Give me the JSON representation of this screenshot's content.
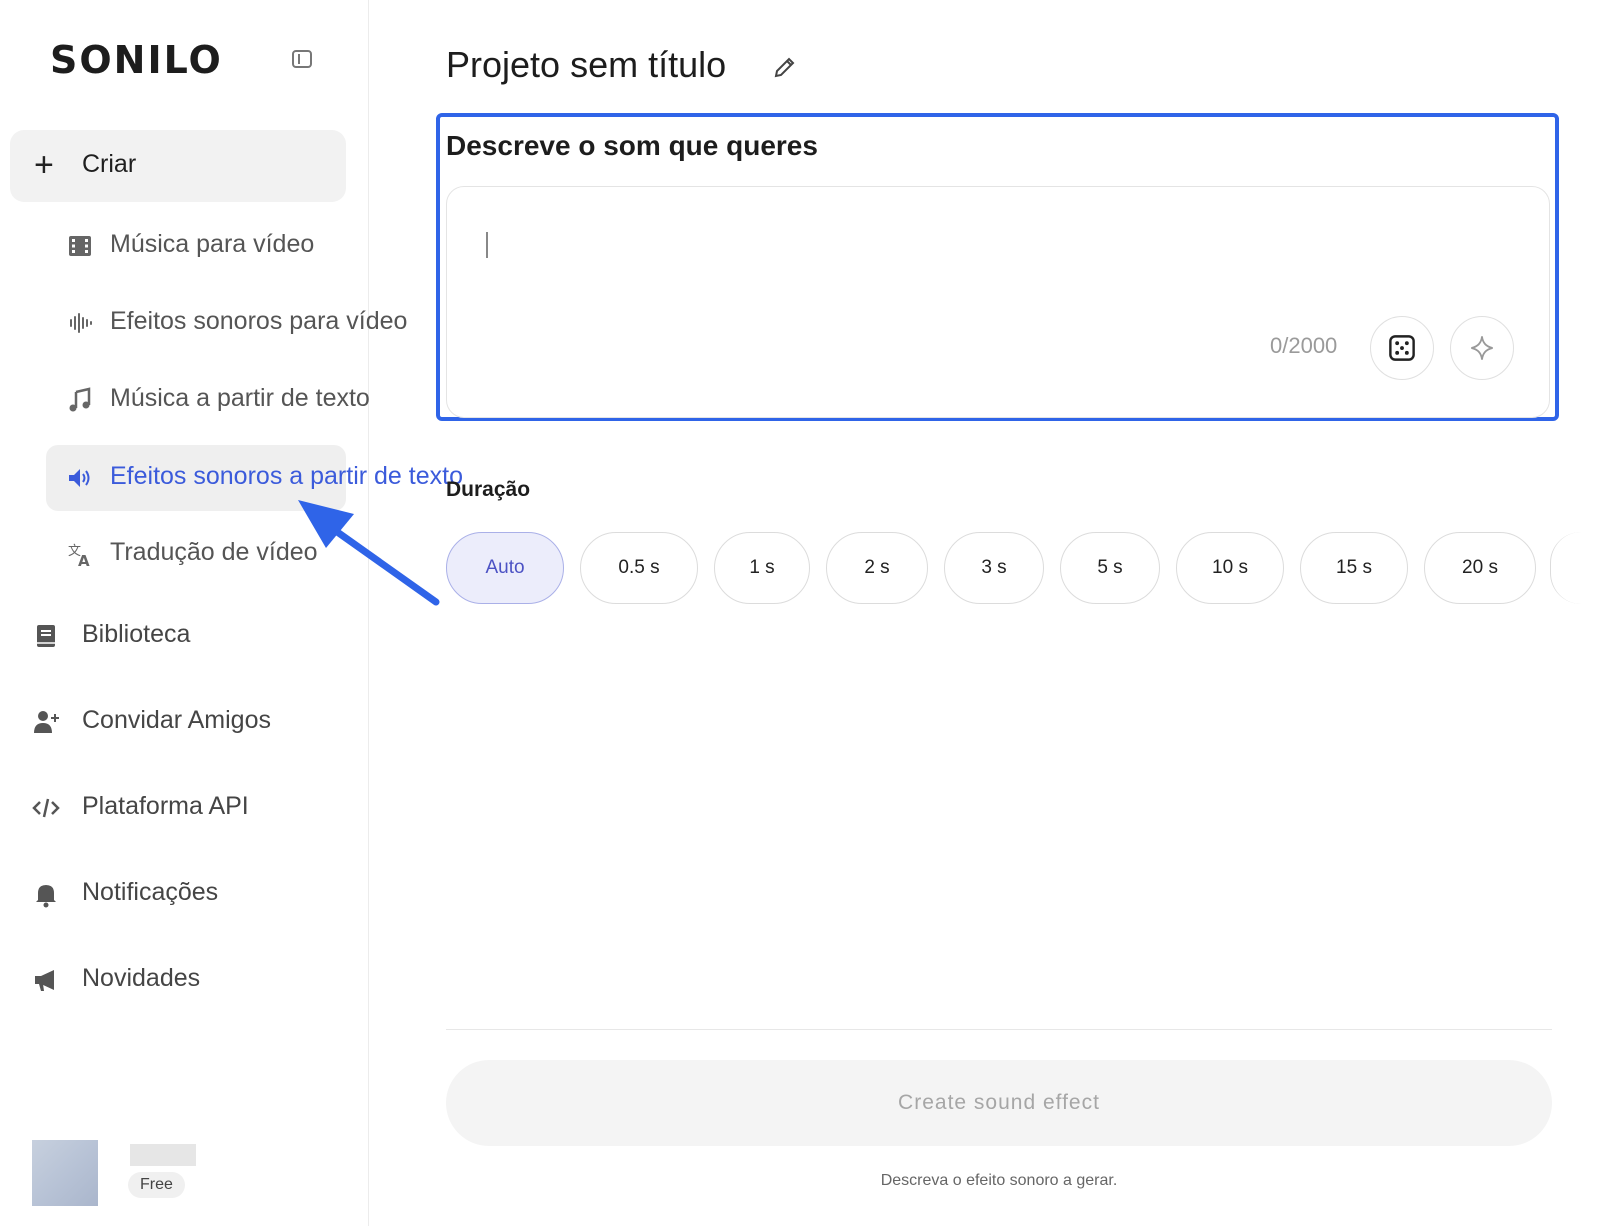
{
  "sidebar": {
    "logo": "SONILO",
    "create_label": "Criar",
    "sub_items": [
      {
        "label": "Música para vídeo",
        "icon": "film-icon"
      },
      {
        "label": "Efeitos sonoros para vídeo",
        "icon": "waveform-icon"
      },
      {
        "label": "Música a partir de texto",
        "icon": "music-note-icon"
      },
      {
        "label": "Efeitos sonoros a partir de texto",
        "icon": "speaker-icon",
        "active": true
      },
      {
        "label": "Tradução de vídeo",
        "icon": "translate-icon"
      }
    ],
    "main_items": [
      {
        "label": "Biblioteca",
        "icon": "book-icon"
      },
      {
        "label": "Convidar Amigos",
        "icon": "add-user-icon"
      },
      {
        "label": "Plataforma API",
        "icon": "code-icon"
      },
      {
        "label": "Notificações",
        "icon": "bell-icon"
      },
      {
        "label": "Novidades",
        "icon": "megaphone-icon"
      }
    ],
    "user_plan": "Free"
  },
  "main": {
    "project_title": "Projeto sem título",
    "prompt_heading": "Descreve o som que queres",
    "prompt_value": "",
    "char_counter": "0/2000",
    "duration_label": "Duração",
    "durations": [
      "Auto",
      "0.5 s",
      "1 s",
      "2 s",
      "3 s",
      "5 s",
      "10 s",
      "15 s",
      "20 s"
    ],
    "selected_duration": "Auto",
    "create_button": "Create sound effect",
    "hint": "Descreva o efeito sonoro a gerar."
  },
  "colors": {
    "accent": "#2f64e8",
    "active_text": "#3b5bdb",
    "chip_selected_bg": "#ecedfb"
  }
}
